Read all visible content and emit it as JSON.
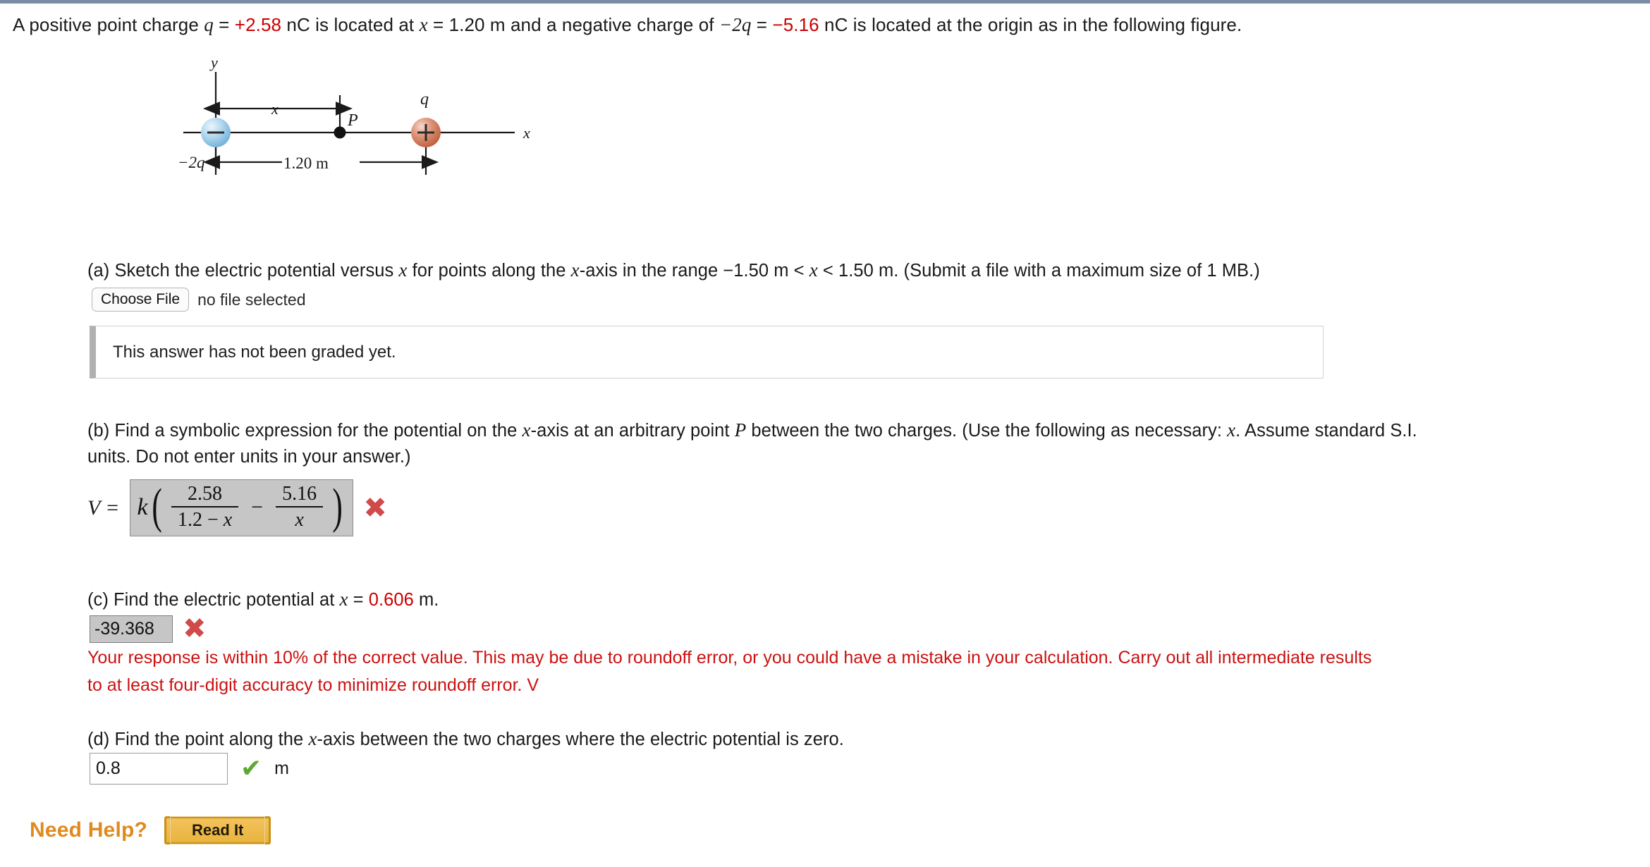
{
  "theme": {
    "top_rule_color": "#7b8ca5",
    "red": "#cc0000",
    "feedback_red": "#cc1111",
    "x_mark_color": "#d04a4a",
    "check_color": "#5ba832",
    "need_help_orange": "#e08a1e",
    "disabled_field_bg": "#c6c6c6",
    "negative_charge_color": "#9ecbe8",
    "positive_charge_color": "#d4785a"
  },
  "prompt": {
    "s1": "A positive point charge ",
    "q": "q",
    "s2": " = ",
    "q_value": "+2.58",
    "s3": " nC  is located at ",
    "x1": "x",
    "s4": " = 1.20 m  and a negative charge of ",
    "neg2q": "−2q",
    "s5": " = ",
    "neg_value": "−5.16",
    "s6": " nC  is located at the origin as in the following figure."
  },
  "figure": {
    "y_axis_label": "y",
    "x_axis_label": "x",
    "point_label": "P",
    "charge_pos_label": "q",
    "charge_neg_label": "−2q",
    "distance_label": "x",
    "separation_label": "1.20 m",
    "pos_sign": "+",
    "neg_sign": "−"
  },
  "part_a": {
    "text_1": "(a) Sketch the electric potential versus ",
    "italic_x_1": "x",
    "text_2": " for points along the ",
    "italic_x_2": "x",
    "text_3": "-axis in the range  −1.50 m < ",
    "italic_x_3": "x",
    "text_4": " < 1.50 m.  (Submit a file with a maximum size of 1 MB.)",
    "choose_file_label": "Choose File",
    "no_file_text": "no file selected",
    "graded_message": "This answer has not been graded yet."
  },
  "part_b": {
    "line1_a": "(b) Find a symbolic expression for the potential on the ",
    "line1_x": "x",
    "line1_b": "-axis at an arbitrary point ",
    "line1_p": "P",
    "line1_c": " between the two charges. (Use the following as necessary: ",
    "line1_x2": "x",
    "line1_d": ". Assume standard S.I.",
    "line2": "units. Do not enter units in your answer.)",
    "v_label": "V =",
    "answer": {
      "k": "k",
      "open_paren": "(",
      "frac1_num": "2.58",
      "frac1_den_a": "1.2 − ",
      "frac1_den_x": "x",
      "operator": "−",
      "frac2_num": "5.16",
      "frac2_den": "x",
      "close_paren": ")"
    },
    "mark": "✖"
  },
  "part_c": {
    "text_1": "(c) Find the electric potential at  ",
    "italic_x": "x",
    "text_2": " = ",
    "x_value": "0.606",
    "text_3": " m.",
    "answer_value": "-39.368",
    "mark": "✖",
    "feedback_line1": "Your response is within 10% of the correct value. This may be due to roundoff error, or you could have a mistake in your calculation. Carry out all intermediate results",
    "feedback_line2": "to at least four-digit accuracy to minimize roundoff error. V"
  },
  "part_d": {
    "text_1": "(d) Find the point along the ",
    "italic_x": "x",
    "text_2": "-axis between the two charges where the electric potential is zero.",
    "answer_value": "0.8",
    "mark": "✔",
    "unit": "m"
  },
  "need_help": {
    "label": "Need Help?",
    "read_it_label": "Read It"
  }
}
